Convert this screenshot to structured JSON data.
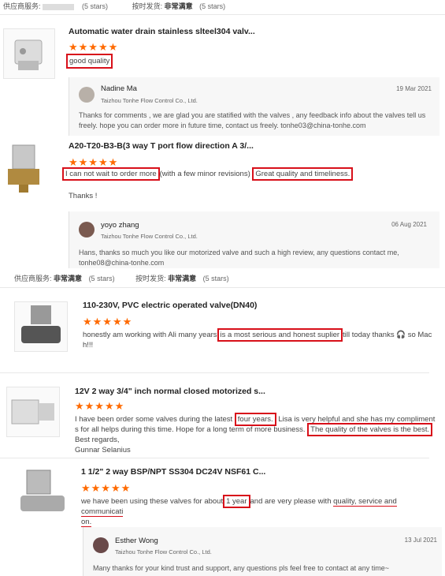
{
  "meta_rows": [
    {
      "service_label": "供应商服务:",
      "service_rating": "",
      "service_stars": "(5 stars)",
      "shipping_label": "按时发货:",
      "shipping_rating": "非常满意",
      "shipping_stars": "(5 stars)"
    },
    {
      "service_label": "供应商服务:",
      "service_rating": "非常满意",
      "service_stars": "(5 stars)",
      "shipping_label": "按时发货:",
      "shipping_rating": "非常满意",
      "shipping_stars": "(5 stars)"
    }
  ],
  "reviews": [
    {
      "product": "Automatic water drain stainless slteel304 valv...",
      "stars": "★★★★★",
      "text": "good quality"
    },
    {
      "product": "A20-T20-B3-B(3 way T port flow direction A 3/...",
      "stars": "★★★★★",
      "text_a": "I can not wait to order more",
      "text_b": "(with a few minor revisions)",
      "text_c": "Great quality and timeliness.",
      "text_d": "Thanks !"
    },
    {
      "product": "110-230V, PVC electric operated valve(DN40)",
      "stars": "★★★★★",
      "text_a": "honestly am working with Ali many years",
      "text_b": "is a most serious and honest suplier",
      "text_c": "till today thanks 🎧 so Mac",
      "text_d": "h!!!"
    },
    {
      "product": "12V 2 way 3/4\" inch normal closed motorized s...",
      "stars": "★★★★★",
      "text_a": "I have been order some valves during the latest",
      "text_b": "four years.",
      "text_c": "Lisa is very helpful and she has my compliment",
      "text_d": "s for all helps during this time. Hope for a long term of more business.",
      "text_e": "The quality of the valves is the best.",
      "text_f": "Best regards,",
      "text_g": "Gunnar Selanius"
    },
    {
      "product": "1 1/2\" 2 way BSP/NPT SS304 DC24V NSF61 C...",
      "stars": "★★★★★",
      "text_a": "we have been using these valves for about",
      "text_b": "1 year",
      "text_c": "and are very please with",
      "text_d": "quality, service and communicati",
      "text_e": "on."
    }
  ],
  "replies": [
    {
      "name": "Nadine Ma",
      "company": "Taizhou Tonhe Flow Control Co., Ltd.",
      "date": "19 Mar 2021",
      "text": "Thanks for comments , we are glad you are statified with the valves , any feedback info about the valves tell us freely.  hope you can order more in future time, contact us freely. tonhe03@china-tonhe.com"
    },
    {
      "name": "yoyo zhang",
      "company": "Taizhou Tonhe Flow Control Co., Ltd.",
      "date": "06 Aug 2021",
      "text": "Hans, thanks so much you like our motorized valve and such a high review,  any questions contact me, tonhe08@china-tonhe.com"
    },
    {
      "name": "Esther Wong",
      "company": "Taizhou Tonhe Flow Control Co., Ltd.",
      "date": "13 Jul 2021",
      "text": "Many thanks for your kind trust and support, any questions pls feel free to contact at any time~"
    }
  ],
  "colors": {
    "accent": "#ff6a00",
    "highlight": "#d8101a"
  }
}
